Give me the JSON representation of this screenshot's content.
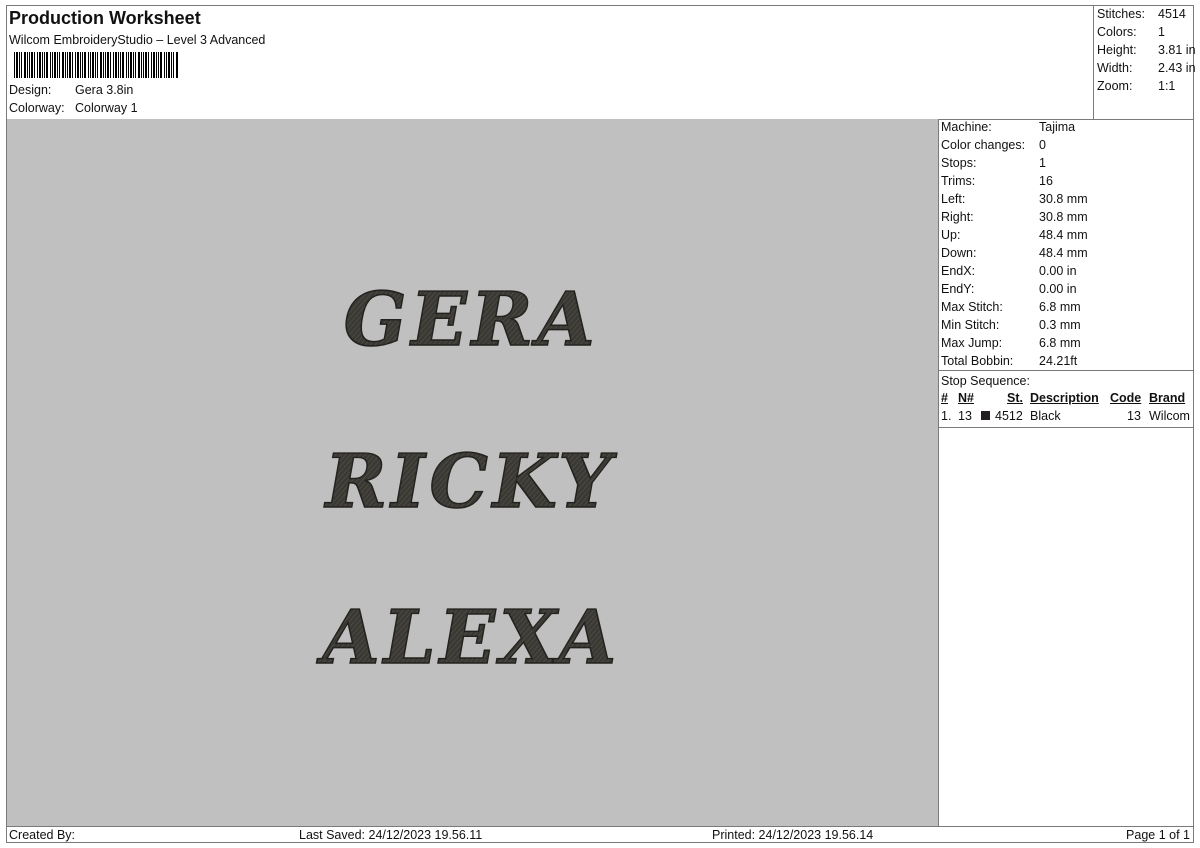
{
  "header": {
    "title": "Production Worksheet",
    "subtitle": "Wilcom EmbroideryStudio – Level 3 Advanced",
    "design_label": "Design:",
    "design_value": "Gera 3.8in",
    "colorway_label": "Colorway:",
    "colorway_value": "Colorway 1"
  },
  "summary": {
    "stitches_label": "Stitches:",
    "stitches": "4514",
    "colors_label": "Colors:",
    "colors": "1",
    "height_label": "Height:",
    "height": "3.81 in",
    "width_label": "Width:",
    "width": "2.43 in",
    "zoom_label": "Zoom:",
    "zoom": "1:1"
  },
  "preview": {
    "background": "#c0c0c0",
    "thread_color": "#3a3833",
    "lines": [
      "GERA",
      "RICKY",
      "ALEXA"
    ]
  },
  "machine_specs": [
    {
      "label": "Machine:",
      "value": "Tajima"
    },
    {
      "label": "Color changes:",
      "value": "0"
    },
    {
      "label": "Stops:",
      "value": "1"
    },
    {
      "label": "Trims:",
      "value": "16"
    },
    {
      "label": "Left:",
      "value": "30.8 mm"
    },
    {
      "label": "Right:",
      "value": "30.8 mm"
    },
    {
      "label": "Up:",
      "value": "48.4 mm"
    },
    {
      "label": "Down:",
      "value": "48.4 mm"
    },
    {
      "label": "EndX:",
      "value": "0.00 in"
    },
    {
      "label": "EndY:",
      "value": "0.00 in"
    },
    {
      "label": "Max Stitch:",
      "value": "6.8 mm"
    },
    {
      "label": "Min Stitch:",
      "value": "0.3 mm"
    },
    {
      "label": "Max Jump:",
      "value": "6.8 mm"
    },
    {
      "label": "Total Bobbin:",
      "value": "24.21ft"
    }
  ],
  "stop_sequence": {
    "title": "Stop Sequence:",
    "headers": {
      "num": "#",
      "n": "N#",
      "st": "St.",
      "description": "Description",
      "code": "Code",
      "brand": "Brand"
    },
    "rows": [
      {
        "num": "1.",
        "n": "13",
        "swatch_color": "#231f20",
        "st": "4512",
        "description": "Black",
        "code": "13",
        "brand": "Wilcom"
      }
    ]
  },
  "footer": {
    "created_by": "Created By:",
    "last_saved": "Last Saved: 24/12/2023 19.56.11",
    "printed": "Printed: 24/12/2023 19.56.14",
    "page": "Page 1 of 1"
  }
}
